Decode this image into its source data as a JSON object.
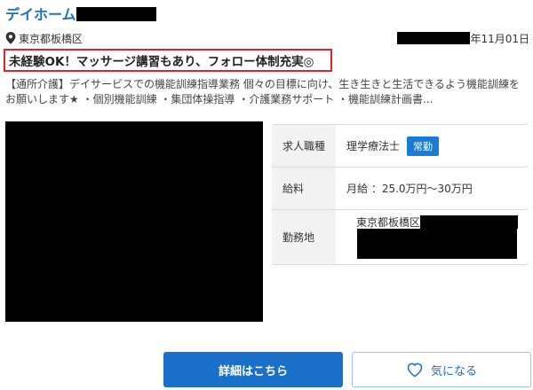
{
  "listing": {
    "company_name": "デイホーム",
    "location": "東京都板橋区",
    "date_suffix": "年11月01日",
    "headline": "未経験OK！マッサージ講習もあり、フォロー体制充実◎",
    "description": "【通所介護】デイサービスでの機能訓練指導業務 個々の目標に向け、生き生きと生活できるよう機能訓練をお願いします★ ・個別機能訓練 ・集団体操指導 ・介護業務サポート ・機能訓練計画書...",
    "details": {
      "job_type_label": "求人職種",
      "job_type_value": "理学療法士",
      "employment_badge": "常勤",
      "salary_label": "給料",
      "salary_value": "月給 ：25.0万円〜30万円",
      "workplace_label": "勤務地",
      "workplace_value": "東京都板橋区"
    }
  },
  "actions": {
    "detail_label": "詳細はこちら",
    "favorite_label": "気になる"
  },
  "colors": {
    "brand": "#1a6fc9",
    "highlight_border": "#d9262c",
    "badge": "#1a7ad4"
  },
  "icons": {
    "location": "map-pin-icon",
    "favorite": "heart-icon"
  }
}
